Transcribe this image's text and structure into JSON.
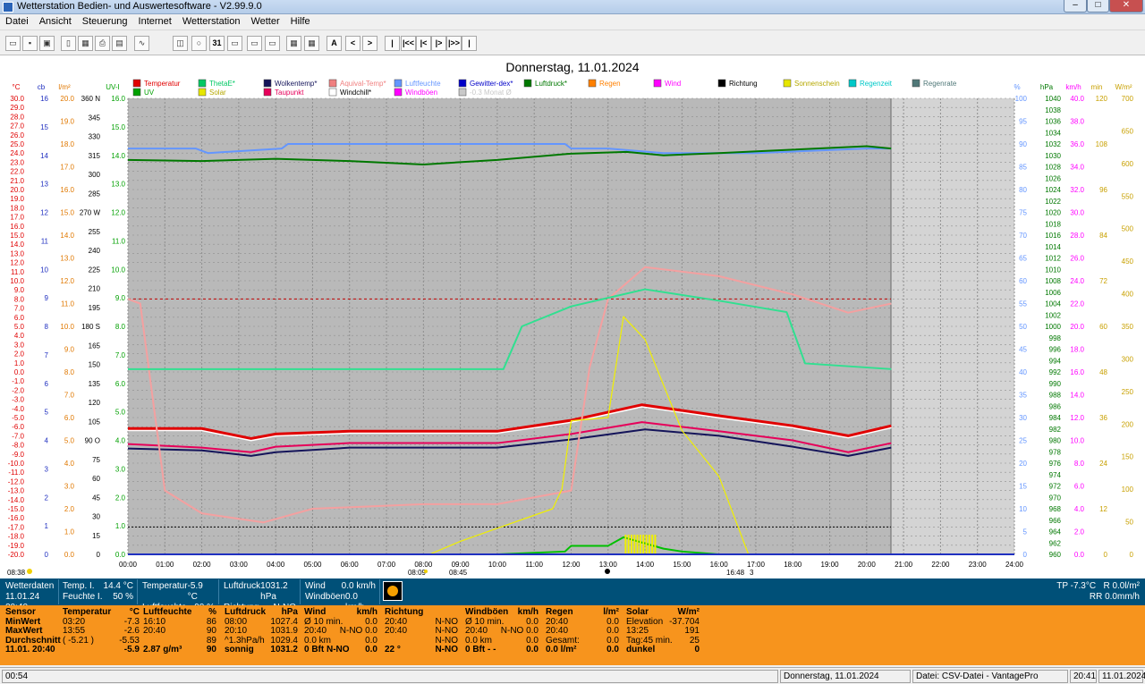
{
  "window": {
    "title": "Wetterstation Bedien- und Auswertesoftware - V2.99.9.0",
    "minimize": "–",
    "maximize": "□",
    "close": "✕"
  },
  "menu": [
    "Datei",
    "Ansicht",
    "Steuerung",
    "Internet",
    "Wetterstation",
    "Wetter",
    "Hilfe"
  ],
  "toolbar": {
    "buttons": [
      "A",
      "<",
      ">",
      "|",
      "|<<",
      "|<",
      "|>",
      "|>>",
      "|"
    ],
    "date_icon": "31"
  },
  "chart": {
    "title": "Donnerstag, 11.01.2024",
    "left_units": [
      "°C",
      "cb",
      "l/m²",
      "UV-I"
    ],
    "right_units": [
      "%",
      "hPa",
      "km/h",
      "min",
      "W/m²"
    ],
    "legend": [
      {
        "label": "Temperatur",
        "color": "#e00000"
      },
      {
        "label": "ThetaE*",
        "color": "#00c864"
      },
      {
        "label": "Wolkentemp*",
        "color": "#14145a"
      },
      {
        "label": "Aquival-Temp*",
        "color": "#f08080"
      },
      {
        "label": "Luftfeuchte",
        "color": "#6496ff"
      },
      {
        "label": "Gewitter-dex*",
        "color": "#0000c8"
      },
      {
        "label": "Luftdruck*",
        "color": "#007800"
      },
      {
        "label": "Regen",
        "color": "#ff8000"
      },
      {
        "label": "Wind",
        "color": "#ff00ff"
      },
      {
        "label": "Richtung",
        "color": "#000000"
      },
      {
        "label": "Sonnenschein",
        "color": "#e6e600"
      },
      {
        "label": "Regenzeit",
        "color": "#00c8c8"
      },
      {
        "label": "Regenrate",
        "color": "#507878"
      },
      {
        "label": "UV",
        "color": "#00a000"
      },
      {
        "label": "Solar",
        "color": "#e6e600"
      },
      {
        "label": "Taupunkt",
        "color": "#e6005a"
      },
      {
        "label": "Windchill*",
        "color": "#ffffff"
      },
      {
        "label": "Windböen",
        "color": "#ff00ff"
      },
      {
        "label": "-0.3 Monat Ø",
        "color": "#c8c8c8"
      }
    ],
    "temp_ticks": [
      "30.0",
      "29.0",
      "28.0",
      "27.0",
      "26.0",
      "25.0",
      "24.0",
      "23.0",
      "22.0",
      "21.0",
      "20.0",
      "19.0",
      "18.0",
      "17.0",
      "16.0",
      "15.0",
      "14.0",
      "13.0",
      "12.0",
      "11.0",
      "10.0",
      "9.0",
      "8.0",
      "7.0",
      "6.0",
      "5.0",
      "4.0",
      "3.0",
      "2.0",
      "1.0",
      "0.0",
      "-1.0",
      "-2.0",
      "-3.0",
      "-4.0",
      "-5.0",
      "-6.0",
      "-7.0",
      "-8.0",
      "-9.0",
      "-10.0",
      "-11.0",
      "-12.0",
      "-13.0",
      "-14.0",
      "-15.0",
      "-16.0",
      "-17.0",
      "-18.0",
      "-19.0",
      "-20.0"
    ],
    "cb_ticks": [
      "16",
      "15",
      "14",
      "13",
      "12",
      "11",
      "10",
      "9",
      "8",
      "7",
      "6",
      "5",
      "4",
      "3",
      "2",
      "1",
      "0"
    ],
    "rain_ticks": [
      "20.0",
      "19.0",
      "18.0",
      "17.0",
      "16.0",
      "15.0",
      "14.0",
      "13.0",
      "12.0",
      "11.0",
      "10.0",
      "9.0",
      "8.0",
      "7.0",
      "6.0",
      "5.0",
      "4.0",
      "3.0",
      "2.0",
      "1.0",
      "0.0"
    ],
    "dir_ticks": [
      "360 N",
      "345",
      "330",
      "315",
      "300",
      "285",
      "270 W",
      "255",
      "240",
      "225",
      "210",
      "195",
      "180 S",
      "165",
      "150",
      "135",
      "120",
      "105",
      "90 O",
      "75",
      "60",
      "45",
      "30",
      "15",
      "0"
    ],
    "uv_ticks": [
      "16.0",
      "15.0",
      "14.0",
      "13.0",
      "12.0",
      "11.0",
      "10.0",
      "9.0",
      "8.0",
      "7.0",
      "6.0",
      "5.0",
      "4.0",
      "3.0",
      "2.0",
      "1.0",
      "0.0"
    ],
    "hum_ticks": [
      "100",
      "95",
      "90",
      "85",
      "80",
      "75",
      "70",
      "65",
      "60",
      "55",
      "50",
      "45",
      "40",
      "35",
      "30",
      "25",
      "20",
      "15",
      "10",
      "5",
      "0"
    ],
    "hpa_ticks": [
      "1040",
      "1038",
      "1036",
      "1034",
      "1032",
      "1030",
      "1028",
      "1026",
      "1024",
      "1022",
      "1020",
      "1018",
      "1016",
      "1014",
      "1012",
      "1010",
      "1008",
      "1006",
      "1004",
      "1002",
      "1000",
      "998",
      "996",
      "994",
      "992",
      "990",
      "988",
      "986",
      "984",
      "982",
      "980",
      "978",
      "976",
      "974",
      "972",
      "970",
      "968",
      "966",
      "964",
      "962",
      "960"
    ],
    "kmh_ticks": [
      "40.0",
      "38.0",
      "36.0",
      "34.0",
      "32.0",
      "30.0",
      "28.0",
      "26.0",
      "24.0",
      "22.0",
      "20.0",
      "18.0",
      "16.0",
      "14.0",
      "12.0",
      "10.0",
      "8.0",
      "6.0",
      "4.0",
      "2.0",
      "0.0"
    ],
    "min_ticks": [
      "120",
      "108",
      "96",
      "84",
      "72",
      "60",
      "48",
      "36",
      "24",
      "12",
      "0"
    ],
    "wm2_ticks": [
      "700",
      "650",
      "600",
      "550",
      "500",
      "450",
      "400",
      "350",
      "300",
      "250",
      "200",
      "150",
      "100",
      "50",
      "0"
    ],
    "x_ticks": [
      "00:00",
      "01:00",
      "02:00",
      "03:00",
      "04:00",
      "05:00",
      "06:00",
      "07:00",
      "08:00",
      "09:00",
      "10:00",
      "11:00",
      "12:00",
      "13:00",
      "14:00",
      "15:00",
      "16:00",
      "17:00",
      "18:00",
      "19:00",
      "20:00",
      "21:00",
      "22:00",
      "23:00",
      "24:00"
    ],
    "markers": {
      "sunrise": "08:09",
      "sunset": "16:48",
      "moon_a": "08:45",
      "moon_b": "3",
      "moonrise": "08:38"
    }
  },
  "chart_data": {
    "type": "line",
    "title": "Donnerstag, 11.01.2024",
    "x_range": [
      "00:00",
      "24:00"
    ],
    "series": [
      {
        "name": "Temperatur",
        "axis": "°C",
        "x": [
          "00:00",
          "02:00",
          "03:20",
          "04:00",
          "06:00",
          "10:00",
          "12:00",
          "13:55",
          "16:00",
          "18:00",
          "19:30",
          "20:40"
        ],
        "values": [
          -6.2,
          -6.2,
          -7.3,
          -6.8,
          -6.5,
          -6.5,
          -5.3,
          -3.6,
          -4.8,
          -5.9,
          -7.0,
          -5.9
        ]
      },
      {
        "name": "Taupunkt",
        "axis": "°C",
        "x": [
          "00:00",
          "02:00",
          "03:20",
          "04:00",
          "06:00",
          "10:00",
          "12:00",
          "13:55",
          "16:00",
          "18:00",
          "19:30",
          "20:40"
        ],
        "values": [
          -7.9,
          -8.3,
          -8.8,
          -8.2,
          -7.8,
          -7.8,
          -6.8,
          -5.5,
          -6.5,
          -7.5,
          -8.8,
          -7.8
        ]
      },
      {
        "name": "Wolkentemp*",
        "axis": "°C",
        "x": [
          "00:00",
          "02:00",
          "03:20",
          "04:00",
          "06:00",
          "10:00",
          "12:00",
          "14:00",
          "16:00",
          "18:00",
          "19:30",
          "20:40"
        ],
        "values": [
          -8.4,
          -8.6,
          -9.2,
          -8.8,
          -8.3,
          -8.3,
          -7.4,
          -6.3,
          -7.0,
          -8.2,
          -9.2,
          -8.3
        ]
      },
      {
        "name": "Aquival-Temp*",
        "axis": "°C",
        "x": [
          "00:00",
          "00:20",
          "01:00",
          "02:00",
          "03:40",
          "05:00",
          "08:00",
          "10:00",
          "12:00",
          "12:30",
          "13:00",
          "14:00",
          "16:00",
          "18:00",
          "19:30",
          "20:40"
        ],
        "values": [
          8.0,
          7.5,
          -13.0,
          -15.5,
          -16.5,
          -15.0,
          -14.5,
          -14.5,
          -13.0,
          0.5,
          8.0,
          11.5,
          10.5,
          8.5,
          6.5,
          7.5
        ]
      },
      {
        "name": "ThetaE*",
        "axis": "UV-I",
        "x": [
          "00:00",
          "10:10",
          "10:40",
          "12:00",
          "13:00",
          "14:00",
          "16:00",
          "17:50",
          "18:20",
          "20:40"
        ],
        "values": [
          6.5,
          6.5,
          8.0,
          8.7,
          9.0,
          9.3,
          8.9,
          8.5,
          6.7,
          6.5
        ]
      },
      {
        "name": "Luftfeuchte",
        "axis": "%",
        "x": [
          "00:00",
          "01:50",
          "02:10",
          "04:10",
          "04:20",
          "08:00",
          "11:50",
          "12:00",
          "13:00",
          "14:30",
          "16:00",
          "17:00",
          "20:00",
          "20:40"
        ],
        "values": [
          89,
          89,
          88,
          89,
          90,
          90,
          90,
          89,
          89,
          88,
          88,
          88,
          89,
          89
        ]
      },
      {
        "name": "Luftdruck*",
        "axis": "hPa",
        "x": [
          "00:00",
          "02:00",
          "04:00",
          "06:00",
          "08:00",
          "10:00",
          "12:00",
          "13:30",
          "14:30",
          "16:00",
          "18:00",
          "20:00",
          "20:40"
        ],
        "values": [
          1029.2,
          1029.0,
          1029.4,
          1029.0,
          1028.4,
          1029.2,
          1030.3,
          1030.6,
          1030.0,
          1030.4,
          1031.0,
          1031.6,
          1031.2
        ]
      },
      {
        "name": "Solar",
        "axis": "W/m²",
        "x": [
          "00:00",
          "08:10",
          "09:00",
          "10:00",
          "11:30",
          "11:45",
          "12:00",
          "13:00",
          "13:25",
          "14:00",
          "15:00",
          "16:00",
          "16:48",
          "24:00"
        ],
        "values": [
          0,
          0,
          20,
          40,
          70,
          100,
          205,
          210,
          365,
          330,
          190,
          120,
          0,
          0
        ]
      },
      {
        "name": "UV",
        "axis": "UV-I",
        "x": [
          "00:00",
          "10:00",
          "11:50",
          "12:00",
          "13:00",
          "13:25",
          "14:30",
          "15:00",
          "16:00",
          "24:00"
        ],
        "values": [
          0.0,
          0.0,
          0.1,
          0.3,
          0.3,
          0.6,
          0.2,
          0.1,
          0.0,
          0.0
        ]
      }
    ],
    "reference_lines": [
      {
        "name": "-0.3 Monat Ø",
        "value": -0.3
      },
      {
        "name": "-7.3",
        "value": 8.0
      }
    ]
  },
  "live": {
    "left": {
      "row1": "Wetterdaten",
      "row2": "11.01.24 20:40"
    },
    "temp": {
      "l1": "Temp. I.",
      "v1": "14.4 °C",
      "l2": "Feuchte I.",
      "v2": "50 %"
    },
    "temp2": {
      "l1": "Temperatur",
      "v1": "-5.9 °C",
      "l2": "Luftfeuchte",
      "v2": "90 %"
    },
    "druck": {
      "l1": "Luftdruck",
      "v1": "1031.2 hPa",
      "l2": "Richtung",
      "v2": "N-NO"
    },
    "wind": {
      "l1": "Wind",
      "v1": "0.0 km/h",
      "l2": "Windböen",
      "v2": "0.0 km/h"
    },
    "right": {
      "l1": "TP -7.3°C",
      "v1": "R 0.0l/m²",
      "l2": "",
      "v2": "RR 0.0mm/h"
    }
  },
  "sensor": {
    "labels": [
      "Sensor",
      "MinWert",
      "MaxWert",
      "Durchschnitt",
      "11.01. 20:40"
    ],
    "temperatur": {
      "h": "Temperatur",
      "u": "°C",
      "rows": [
        [
          "03:20",
          "-7.3"
        ],
        [
          "13:55",
          "-2.6"
        ],
        [
          "( -5.21 )",
          "-5.53"
        ],
        [
          "",
          "-5.9"
        ]
      ]
    },
    "luftfeuchte": {
      "h": "Luftfeuchte",
      "u": "%",
      "rows": [
        [
          "16:10",
          "86"
        ],
        [
          "20:40",
          "90"
        ],
        [
          "",
          "89"
        ],
        [
          "2.87 g/m³",
          "90"
        ]
      ]
    },
    "luftdruck": {
      "h": "Luftdruck",
      "u": "hPa",
      "rows": [
        [
          "08:00",
          "1027.4"
        ],
        [
          "20:10",
          "1031.9"
        ],
        [
          "^1.3hPa/h",
          "1029.4"
        ],
        [
          "sonnig",
          "1031.2"
        ]
      ]
    },
    "wind": {
      "h": "Wind",
      "u": "km/h",
      "rows": [
        [
          "Ø 10 min.",
          "0.0"
        ],
        [
          "20:40",
          "N-NO 0.0"
        ],
        [
          "0.0 km",
          "0.0"
        ],
        [
          "0 Bft N-NO",
          "0.0"
        ]
      ]
    },
    "richtung": {
      "h": "Richtung",
      "u": "",
      "rows": [
        [
          "20:40",
          "N-NO"
        ],
        [
          "20:40",
          "N-NO"
        ],
        [
          "",
          "N-NO"
        ],
        [
          "22 °",
          "N-NO"
        ]
      ]
    },
    "windboeen": {
      "h": "Windböen",
      "u": "km/h",
      "rows": [
        [
          "Ø 10 min.",
          "0.0"
        ],
        [
          "20:40",
          "N-NO 0.0"
        ],
        [
          "0.0 km",
          "0.0"
        ],
        [
          "0 Bft - -",
          "0.0"
        ]
      ]
    },
    "regen": {
      "h": "Regen",
      "u": "l/m²",
      "rows": [
        [
          "20:40",
          "0.0"
        ],
        [
          "20:40",
          "0.0"
        ],
        [
          "Gesamt:",
          "0.0"
        ],
        [
          "0.0 l/m²",
          "0.0"
        ]
      ]
    },
    "solar": {
      "h": "Solar",
      "u": "W/m²",
      "rows": [
        [
          "Elevation",
          "-37.704"
        ],
        [
          "13:25",
          "191"
        ],
        [
          "Tag:45 min.",
          "25"
        ],
        [
          "dunkel",
          "0"
        ]
      ]
    }
  },
  "statusbar": {
    "left": "00:54",
    "date": "Donnerstag, 11.01.2024",
    "file": "Datei: CSV-Datei - VantagePro",
    "time": "20:41",
    "date2": "11.01.2024"
  }
}
